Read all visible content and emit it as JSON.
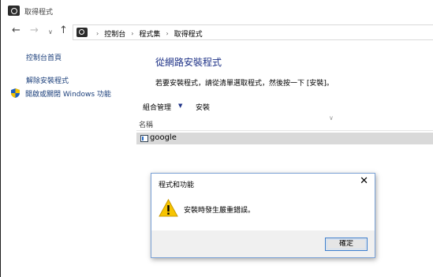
{
  "window": {
    "title": "取得程式"
  },
  "nav": {
    "back": "←",
    "forward": "→",
    "dropdown": "∨",
    "up": "↑",
    "breadcrumbs": [
      "控制台",
      "程式集",
      "取得程式"
    ],
    "separator": "›"
  },
  "sidebar": {
    "items": [
      {
        "label": "控制台首頁"
      },
      {
        "label": "解除安裝程式"
      },
      {
        "label": "開啟或關閉 Windows 功能"
      }
    ]
  },
  "main": {
    "heading": "從網路安裝程式",
    "description": "若要安裝程式，請從清單選取程式，然後按一下 [安裝]。",
    "toolbar": {
      "organize": "組合管理",
      "organize_caret": "▼",
      "install": "安裝"
    },
    "list": {
      "column_name": "名稱",
      "sort_icon": "∨",
      "rows": [
        {
          "label": "google"
        }
      ]
    }
  },
  "dialog": {
    "title": "程式和功能",
    "close": "✕",
    "message": "安裝時發生嚴重錯誤。",
    "ok_label": "確定"
  },
  "colors": {
    "link": "#1a3e7a",
    "heading": "#1e3287",
    "selected_row": "#d9d9d9",
    "dialog_bg": "#f0f0f0",
    "button_border": "#3c7fd0",
    "warning": "#f7c400"
  }
}
